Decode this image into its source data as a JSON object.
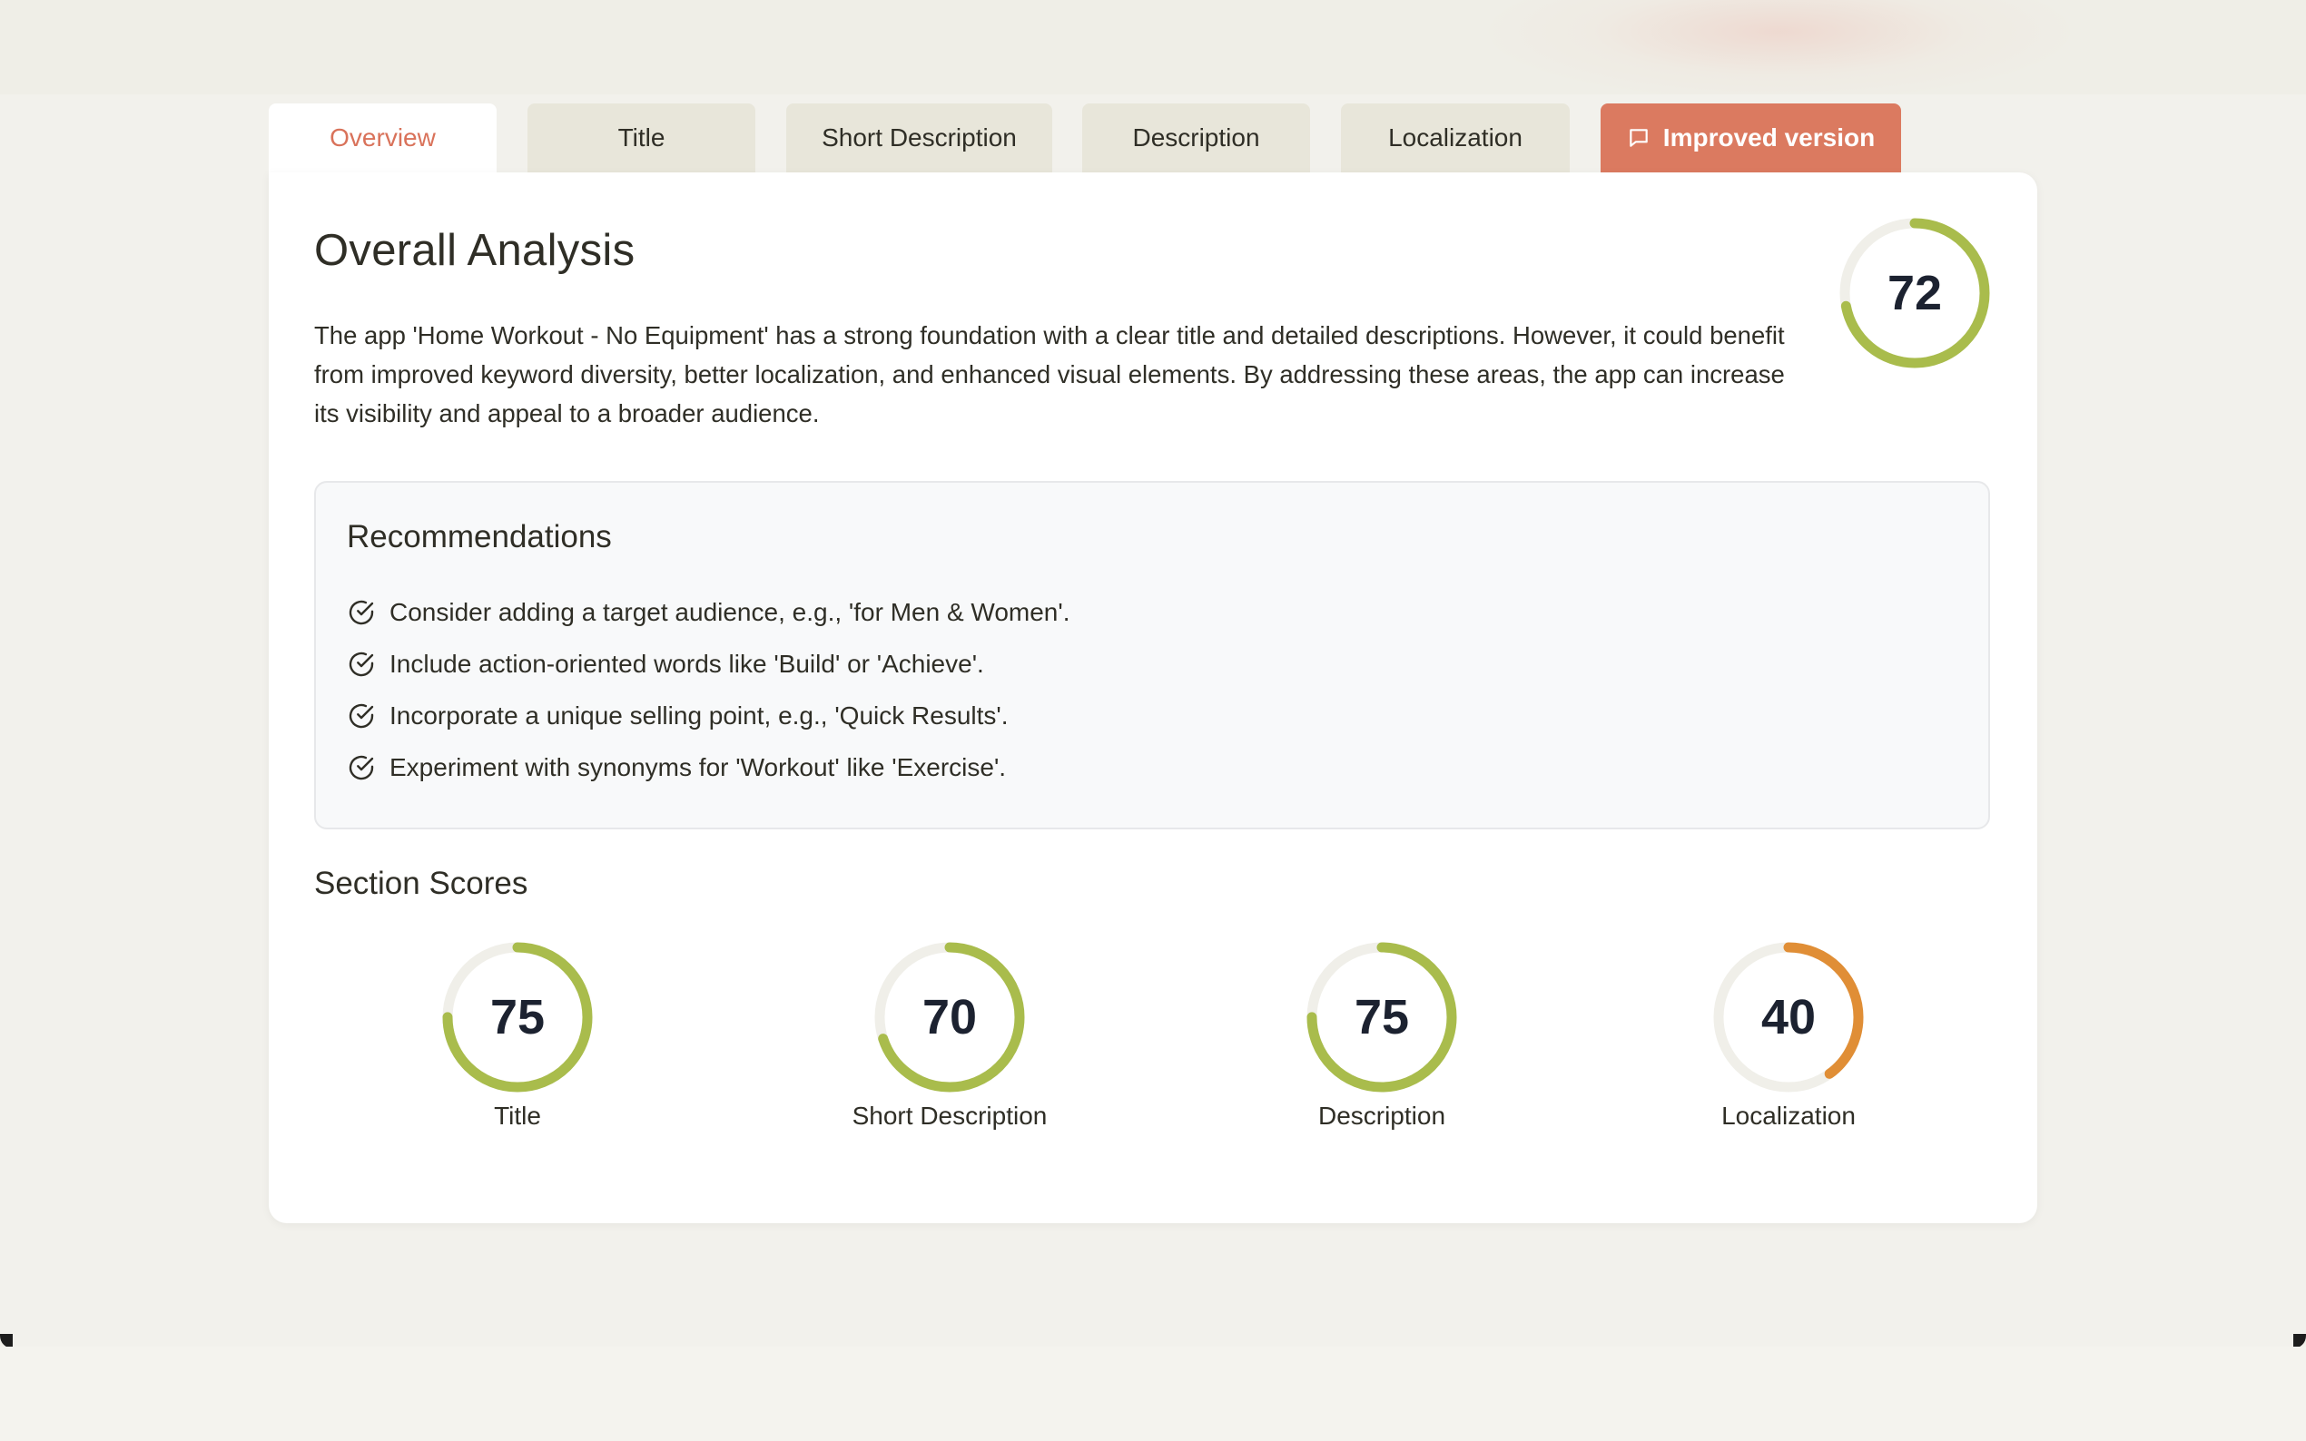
{
  "tabs": [
    {
      "label": "Overview",
      "active": true
    },
    {
      "label": "Title"
    },
    {
      "label": "Short Description"
    },
    {
      "label": "Description"
    },
    {
      "label": "Localization"
    },
    {
      "label": "Improved version",
      "icon": "message-square-icon"
    }
  ],
  "overall": {
    "title": "Overall Analysis",
    "text": "The app 'Home Workout - No Equipment' has a strong foundation with a clear title and detailed descriptions. However, it could benefit from improved keyword diversity, better localization, and enhanced visual elements. By addressing these areas, the app can increase its visibility and appeal to a broader audience.",
    "score": 72
  },
  "recommendations": {
    "title": "Recommendations",
    "icon": "check-circle-icon",
    "items": [
      "Consider adding a target audience, e.g., 'for Men & Women'.",
      "Include action-oriented words like 'Build' or 'Achieve'.",
      "Incorporate a unique selling point, e.g., 'Quick Results'.",
      "Experiment with synonyms for 'Workout' like 'Exercise'."
    ]
  },
  "section_scores": {
    "title": "Section Scores",
    "items": [
      {
        "label": "Title",
        "score": 75,
        "color": "#a9bc4c"
      },
      {
        "label": "Short Description",
        "score": 70,
        "color": "#a9bc4c"
      },
      {
        "label": "Description",
        "score": 75,
        "color": "#a9bc4c"
      },
      {
        "label": "Localization",
        "score": 40,
        "color": "#e08e36"
      }
    ]
  },
  "colors": {
    "accent": "#db7a60",
    "good": "#a9bc4c",
    "warn": "#e08e36",
    "track": "#f0efe9"
  }
}
